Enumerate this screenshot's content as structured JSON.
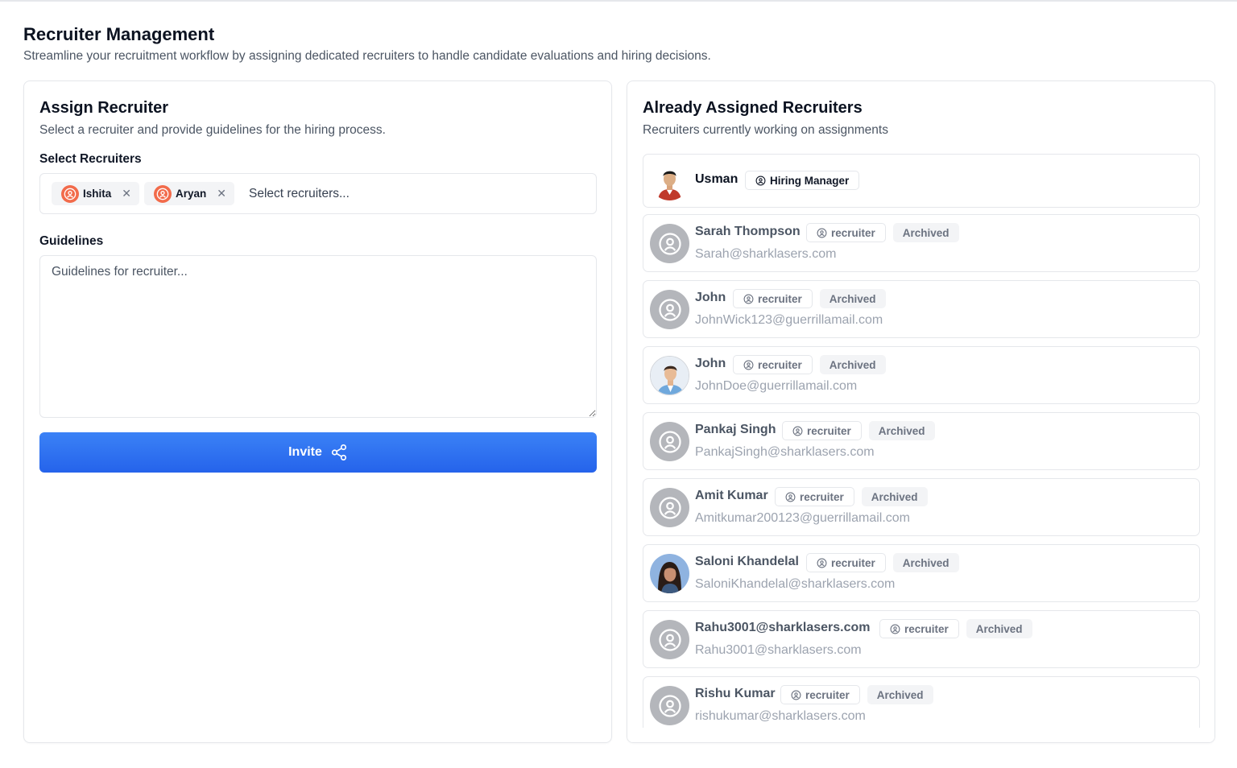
{
  "page": {
    "title": "Recruiter Management",
    "subtitle": "Streamline your recruitment workflow by assigning dedicated recruiters to handle candidate evaluations and hiring decisions."
  },
  "assign": {
    "title": "Assign Recruiter",
    "description": "Select a recruiter and provide guidelines for the hiring process.",
    "select_label": "Select Recruiters",
    "selected": [
      {
        "name": "Ishita",
        "avatar_icon": "user-circle-icon"
      },
      {
        "name": "Aryan",
        "avatar_icon": "user-circle-icon"
      }
    ],
    "remove_icon": "close-icon",
    "select_placeholder": "Select recruiters...",
    "guidelines_label": "Guidelines",
    "guidelines_placeholder": "Guidelines for recruiter...",
    "guidelines_value": "",
    "invite_label": "Invite",
    "invite_icon": "share-icon"
  },
  "assigned": {
    "title": "Already Assigned Recruiters",
    "description": "Recruiters currently working on assignments",
    "recruiters": [
      {
        "name": "Usman",
        "role": "Hiring Manager",
        "email": "",
        "status": "",
        "avatar": "photo-man-red-shirt"
      },
      {
        "name": "Sarah Thompson",
        "role": "recruiter",
        "email": "Sarah@sharklasers.com",
        "status": "Archived",
        "avatar": "default-user-icon"
      },
      {
        "name": "John",
        "role": "recruiter",
        "email": "JohnWick123@guerrillamail.com",
        "status": "Archived",
        "avatar": "default-user-icon"
      },
      {
        "name": "John",
        "role": "recruiter",
        "email": "JohnDoe@guerrillamail.com",
        "status": "Archived",
        "avatar": "photo-man-blue-shirt"
      },
      {
        "name": "Pankaj Singh",
        "role": "recruiter",
        "email": "PankajSingh@sharklasers.com",
        "status": "Archived",
        "avatar": "default-user-icon"
      },
      {
        "name": "Amit Kumar",
        "role": "recruiter",
        "email": "Amitkumar200123@guerrillamail.com",
        "status": "Archived",
        "avatar": "default-user-icon"
      },
      {
        "name": "Saloni Khandelal",
        "role": "recruiter",
        "email": "SaloniKhandelal@sharklasers.com",
        "status": "Archived",
        "avatar": "photo-woman"
      },
      {
        "name": "Rahu3001@sharklasers.com",
        "role": "recruiter",
        "email": "Rahu3001@sharklasers.com",
        "status": "Archived",
        "avatar": "default-user-icon"
      },
      {
        "name": "Rishu Kumar",
        "role": "recruiter",
        "email": "rishukumar@sharklasers.com",
        "status": "Archived",
        "avatar": "default-user-icon"
      }
    ]
  },
  "colors": {
    "primary": "#2563eb",
    "chip_avatar": "#f26b4b",
    "border": "#e5e7eb",
    "muted_text": "#9ca3af"
  }
}
